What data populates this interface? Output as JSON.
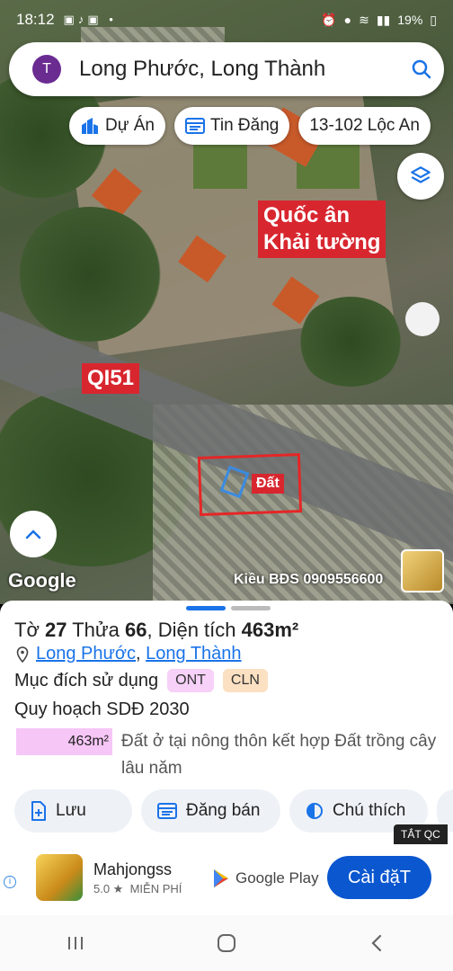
{
  "status_bar": {
    "time": "18:12",
    "battery": "19%"
  },
  "search": {
    "avatar_letter": "T",
    "query": "Long Phước, Long Thành"
  },
  "chips": [
    {
      "label": "Dự Án",
      "icon": "building-icon"
    },
    {
      "label": "Tin Đăng",
      "icon": "list-icon"
    },
    {
      "label": "13-102 Lộc An",
      "icon": ""
    }
  ],
  "map": {
    "labels": {
      "landmark_line1": "Quốc ân",
      "landmark_line2": "Khải tường",
      "road": "QI51",
      "parcel": "Đất"
    },
    "google": "Google",
    "watermark": "Kiều BĐS 0909556600"
  },
  "parcel_info": {
    "to_label": "Tờ",
    "to_value": "27",
    "thua_label": "Thửa",
    "thua_value": "66",
    "area_label": "Diện tích",
    "area_value": "463m²",
    "ward": "Long Phước",
    "district": "Long Thành",
    "purpose_label": "Mục đích sử dụng",
    "badges": [
      {
        "label": "ONT",
        "color": "#f7d1f7"
      },
      {
        "label": "CLN",
        "color": "#fbe0c2"
      }
    ],
    "plan_label": "Quy hoạch SDĐ 2030",
    "plan_area": "463m²",
    "plan_desc": "Đất ở tại nông thôn kết hợp Đất trồng cây lâu năm"
  },
  "actions": [
    {
      "label": "Lưu",
      "icon": "save-file-icon"
    },
    {
      "label": "Đăng bán",
      "icon": "calendar-icon"
    },
    {
      "label": "Chú thích",
      "icon": "legend-icon"
    }
  ],
  "ad": {
    "close_label": "TẮT QC",
    "app_name": "Mahjongss",
    "rating": "5.0 ★",
    "price": "MIỄN PHÍ",
    "store": "Google Play",
    "install_label": "Cài đặT"
  },
  "colors": {
    "accent": "#1a73e8",
    "marker_red": "#d8262f",
    "install_blue": "#0b57d0"
  }
}
